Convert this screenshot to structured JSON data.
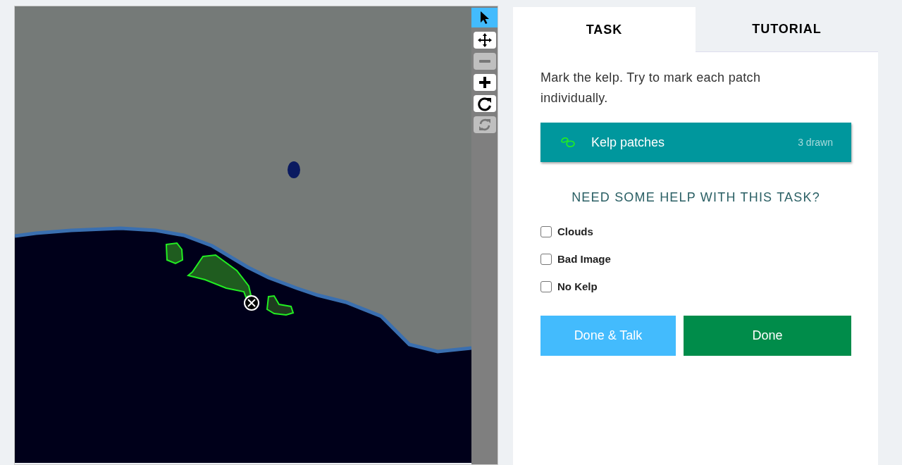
{
  "map_tools": [
    {
      "kind": "pointer",
      "selected": true,
      "disabled": false
    },
    {
      "kind": "move",
      "selected": false,
      "disabled": false
    },
    {
      "kind": "zoom-out",
      "selected": false,
      "disabled": true
    },
    {
      "kind": "zoom-in",
      "selected": false,
      "disabled": false
    },
    {
      "kind": "rotate",
      "selected": false,
      "disabled": false
    },
    {
      "kind": "reset",
      "selected": false,
      "disabled": true
    }
  ],
  "tabs": [
    {
      "label": "TASK",
      "selected": true
    },
    {
      "label": "TUTORIAL",
      "selected": false
    }
  ],
  "instruction": "Mark the kelp. Try to mark each patch individually.",
  "drawing_tool": {
    "label": "Kelp patches",
    "count": "3 drawn"
  },
  "help_heading": "NEED SOME HELP WITH THIS TASK?",
  "checkboxes": [
    {
      "label": "Clouds",
      "checked": false
    },
    {
      "label": "Bad Image",
      "checked": false
    },
    {
      "label": "No Kelp",
      "checked": false
    }
  ],
  "buttons": [
    {
      "label": "Done & Talk",
      "kind": "secondary"
    },
    {
      "label": "Done",
      "kind": "primary"
    }
  ]
}
